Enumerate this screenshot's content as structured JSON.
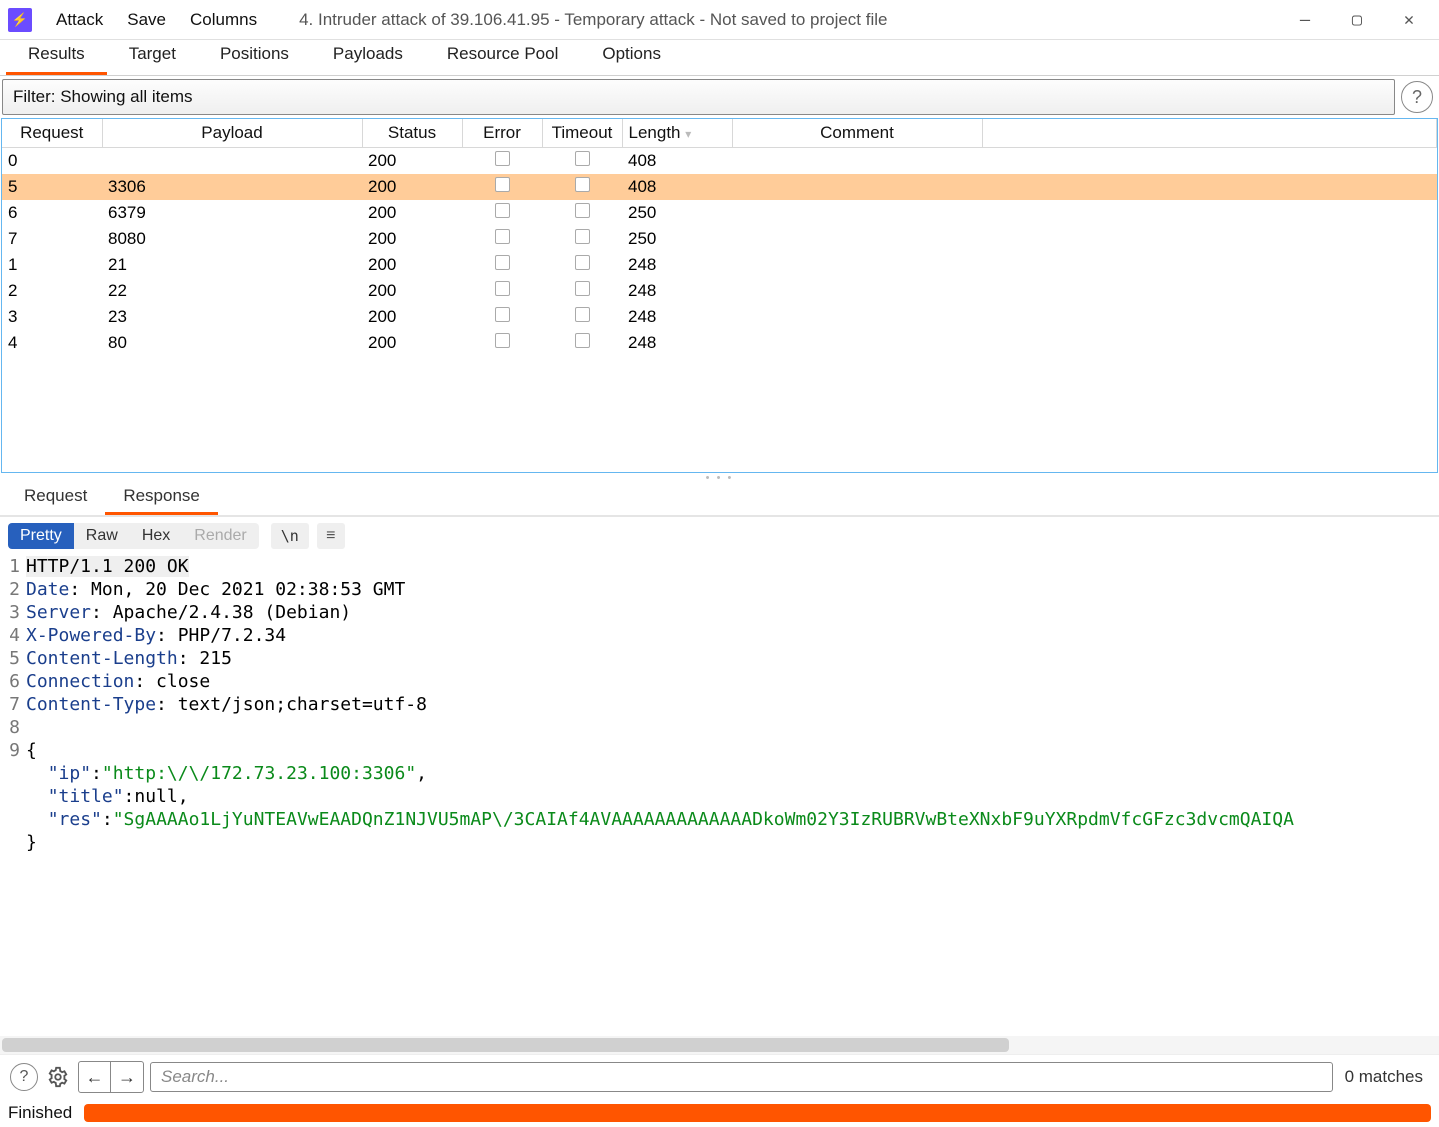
{
  "titlebar": {
    "menus": [
      "Attack",
      "Save",
      "Columns"
    ],
    "title": "4. Intruder attack of 39.106.41.95 - Temporary attack - Not saved to project file"
  },
  "maintabs": {
    "items": [
      "Results",
      "Target",
      "Positions",
      "Payloads",
      "Resource Pool",
      "Options"
    ],
    "active": 0
  },
  "filter": {
    "text": "Filter: Showing all items"
  },
  "columns": [
    "Request",
    "Payload",
    "Status",
    "Error",
    "Timeout",
    "Length",
    "Comment"
  ],
  "sort": {
    "column": "Length",
    "dir": "desc"
  },
  "rows": [
    {
      "request": "0",
      "payload": "",
      "status": "200",
      "length": "408",
      "selected": false
    },
    {
      "request": "5",
      "payload": "3306",
      "status": "200",
      "length": "408",
      "selected": true
    },
    {
      "request": "6",
      "payload": "6379",
      "status": "200",
      "length": "250",
      "selected": false
    },
    {
      "request": "7",
      "payload": "8080",
      "status": "200",
      "length": "250",
      "selected": false
    },
    {
      "request": "1",
      "payload": "21",
      "status": "200",
      "length": "248",
      "selected": false
    },
    {
      "request": "2",
      "payload": "22",
      "status": "200",
      "length": "248",
      "selected": false
    },
    {
      "request": "3",
      "payload": "23",
      "status": "200",
      "length": "248",
      "selected": false
    },
    {
      "request": "4",
      "payload": "80",
      "status": "200",
      "length": "248",
      "selected": false
    }
  ],
  "detailtabs": {
    "items": [
      "Request",
      "Response"
    ],
    "active": 1
  },
  "viewmodes": {
    "items": [
      "Pretty",
      "Raw",
      "Hex",
      "Render"
    ],
    "active": 0,
    "disabled": [
      3
    ]
  },
  "chip": "\\n",
  "response": {
    "status_line": "HTTP/1.1 200 OK",
    "headers": [
      [
        "Date",
        "Mon, 20 Dec 2021 02:38:53 GMT"
      ],
      [
        "Server",
        "Apache/2.4.38 (Debian)"
      ],
      [
        "X-Powered-By",
        "PHP/7.2.34"
      ],
      [
        "Content-Length",
        "215"
      ],
      [
        "Connection",
        "close"
      ],
      [
        "Content-Type",
        "text/json;charset=utf-8"
      ]
    ],
    "body": {
      "ip_key": "\"ip\"",
      "ip_val": "\"http:\\/\\/172.73.23.100:3306\"",
      "title_key": "\"title\"",
      "title_val": "null",
      "res_key": "\"res\"",
      "res_val": "\"SgAAAAo1LjYuNTEAVwEAADQnZ1NJVU5mAP\\/3CAIAf4AVAAAAAAAAAAAAADkoWm02Y3IzRUBRVwBteXNxbF9uYXRpdmVfcGFzc3dvcmQAIQA"
    }
  },
  "search": {
    "placeholder": "Search...",
    "matches": "0 matches"
  },
  "status": {
    "label": "Finished"
  }
}
